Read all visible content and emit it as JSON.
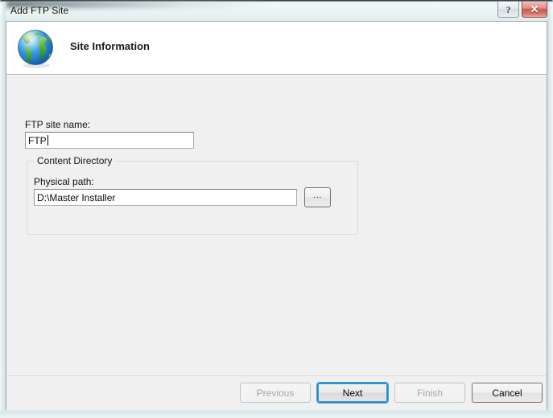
{
  "window": {
    "title": "Add FTP Site",
    "help_button_glyph": "?",
    "close_button_glyph": "✕",
    "help_icon_name": "help-icon",
    "close_icon_name": "close-icon"
  },
  "header": {
    "icon": "globe-icon",
    "title": "Site Information"
  },
  "form": {
    "site_name": {
      "label": "FTP site name:",
      "value": "FTP",
      "placeholder": ""
    },
    "content_directory": {
      "legend": "Content Directory",
      "physical_path": {
        "label": "Physical path:",
        "value": "D:\\Master Installer",
        "placeholder": ""
      },
      "browse_button": {
        "label": "...",
        "icon": "ellipsis-icon"
      }
    }
  },
  "footer": {
    "buttons": [
      {
        "label": "Previous",
        "state": "disabled"
      },
      {
        "label": "Next",
        "state": "focused"
      },
      {
        "label": "Finish",
        "state": "disabled"
      },
      {
        "label": "Cancel",
        "state": "enabled"
      }
    ]
  },
  "colors": {
    "accent_focus": "#37a7e8",
    "close_button_red": "#c7584e",
    "client_background": "#f0f0f0",
    "header_background": "#ffffff",
    "globe_ocean": "#2a87d0",
    "globe_land": "#4fae3f"
  }
}
